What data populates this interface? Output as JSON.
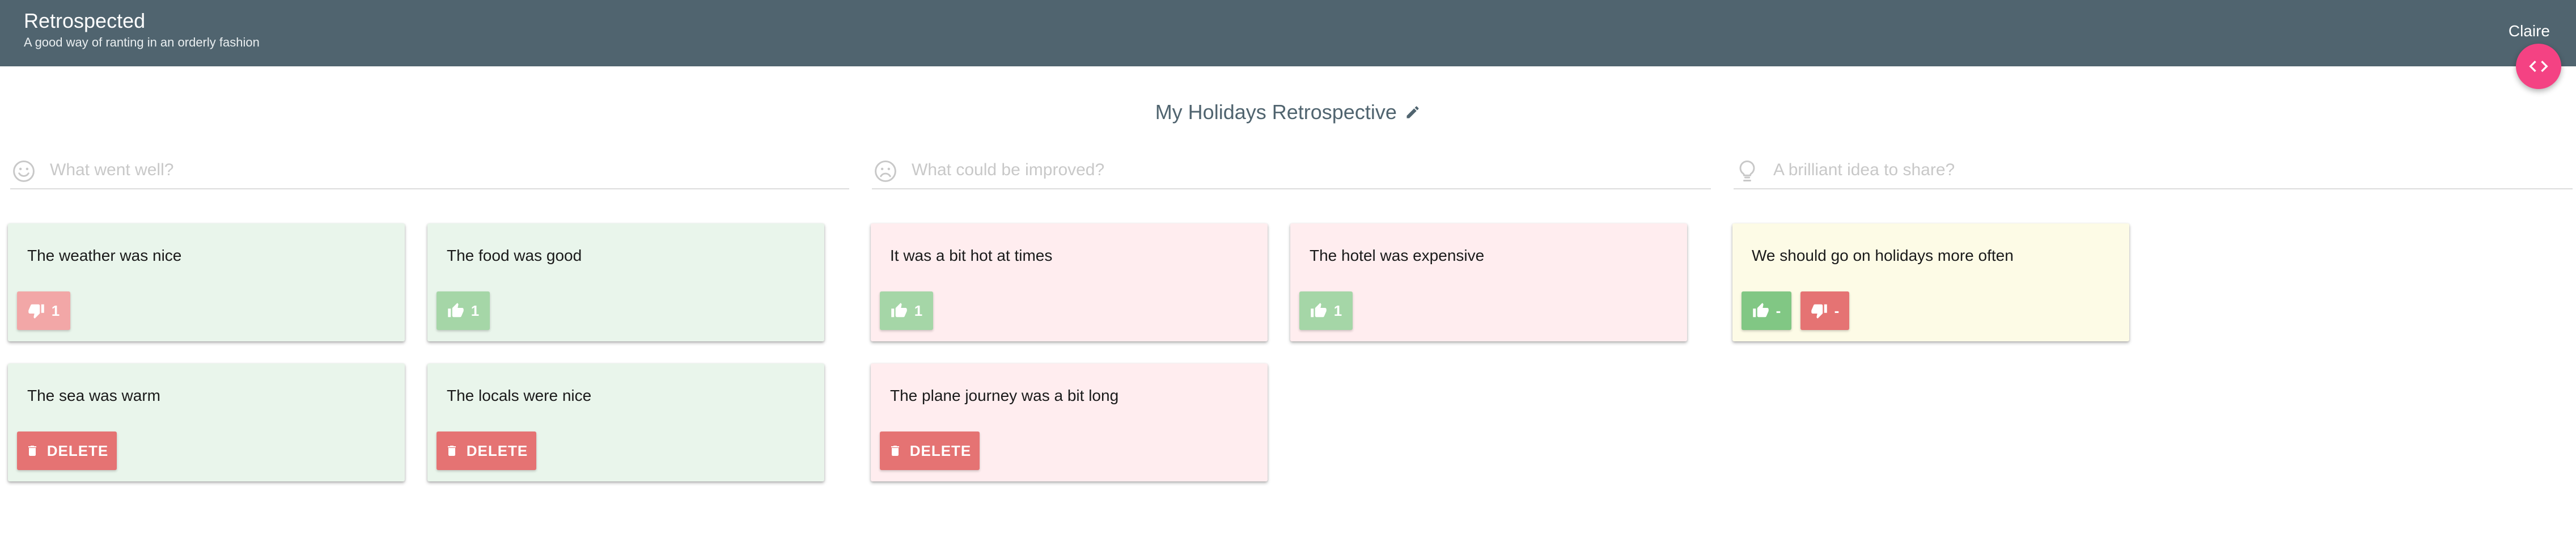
{
  "app": {
    "title": "Retrospected",
    "subtitle": "A good way of ranting in an orderly fashion",
    "user": "Claire"
  },
  "session": {
    "title": "My Holidays Retrospective"
  },
  "columns": [
    {
      "placeholder": "What went well?",
      "icon": "smile-icon",
      "color": "#e9f5eb",
      "posts": [
        {
          "text": "The weather was nice",
          "action": "dislike",
          "count": "1"
        },
        {
          "text": "The food was good",
          "action": "like",
          "count": "1"
        },
        {
          "text": "The sea was warm",
          "action": "delete",
          "label": "DELETE"
        },
        {
          "text": "The locals were nice",
          "action": "delete",
          "label": "DELETE"
        }
      ]
    },
    {
      "placeholder": "What could be improved?",
      "icon": "frown-icon",
      "color": "#ffedef",
      "posts": [
        {
          "text": "It was a bit hot at times",
          "action": "like",
          "count": "1"
        },
        {
          "text": "The hotel was expensive",
          "action": "like",
          "count": "1"
        },
        {
          "text": "The plane journey was a bit long",
          "action": "delete",
          "label": "DELETE"
        }
      ]
    },
    {
      "placeholder": "A brilliant idea to share?",
      "icon": "lightbulb-icon",
      "color": "#fdfbe6",
      "posts": [
        {
          "text": "We should go on holidays more often",
          "like_count": "-",
          "dislike_count": "-"
        }
      ]
    }
  ]
}
